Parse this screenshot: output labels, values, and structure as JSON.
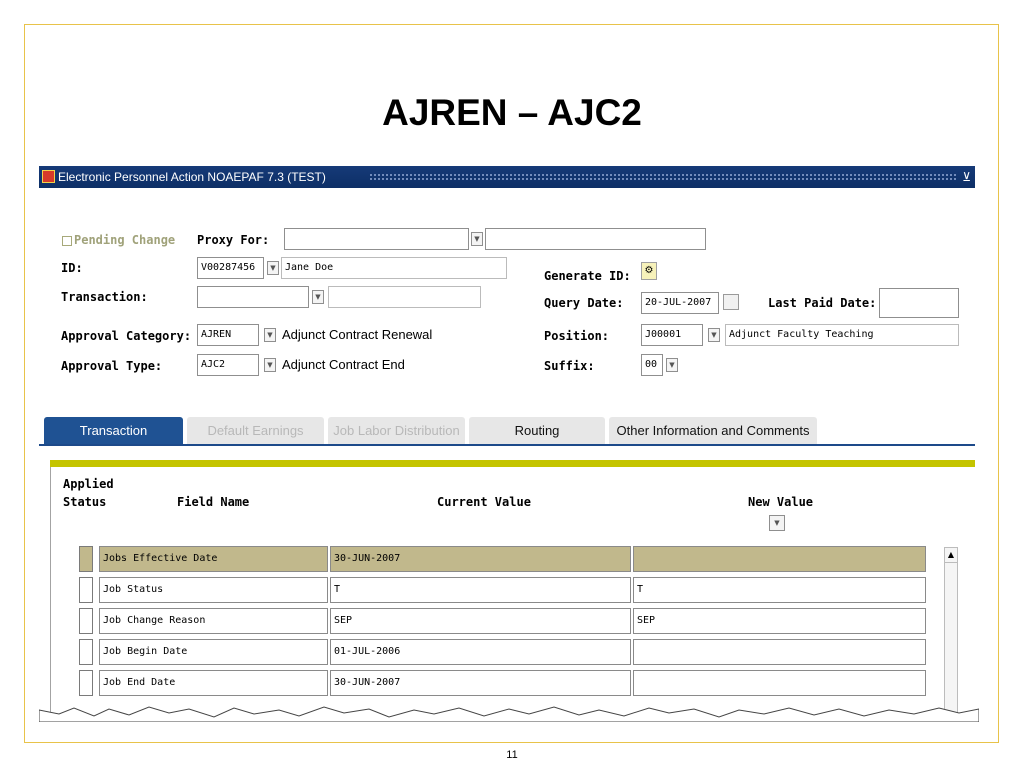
{
  "slide": {
    "title": "AJREN – AJC2",
    "page_number": "11"
  },
  "window": {
    "title": "Electronic Personnel Action  NOAEPAF  7.3  (TEST)",
    "close_glyph": "⊻"
  },
  "form": {
    "pending_change_label": "Pending Change",
    "proxy_for_label": "Proxy For:",
    "proxy_for_value": "",
    "proxy_for_name": "",
    "id_label": "ID:",
    "id_value": "V00287456",
    "id_name": "Jane Doe",
    "transaction_label": "Transaction:",
    "transaction_value": "",
    "transaction_desc": "",
    "approval_category_label": "Approval Category:",
    "approval_category_value": "AJREN",
    "approval_category_desc": "Adjunct Contract Renewal",
    "approval_type_label": "Approval Type:",
    "approval_type_value": "AJC2",
    "approval_type_desc": "Adjunct Contract End",
    "generate_id_label": "Generate ID:",
    "query_date_label": "Query Date:",
    "query_date_value": "20-JUL-2007",
    "last_paid_date_label": "Last Paid Date:",
    "last_paid_date_value": "",
    "position_label": "Position:",
    "position_value": "J00001",
    "position_desc": "Adjunct Faculty Teaching",
    "suffix_label": "Suffix:",
    "suffix_value": "00"
  },
  "tabs": [
    {
      "label": "Transaction",
      "state": "active"
    },
    {
      "label": "Default Earnings",
      "state": "disabled"
    },
    {
      "label": "Job Labor Distribution",
      "state": "disabled"
    },
    {
      "label": "Routing",
      "state": "normal"
    },
    {
      "label": "Other Information and Comments",
      "state": "normal"
    }
  ],
  "grid": {
    "applied_header": "Applied",
    "status_header": "Status",
    "field_name_header": "Field Name",
    "current_value_header": "Current Value",
    "new_value_header": "New Value",
    "rows": [
      {
        "field": "Jobs Effective Date",
        "current": "30-JUN-2007",
        "new": ""
      },
      {
        "field": "Job Status",
        "current": "T",
        "new": "T"
      },
      {
        "field": "Job Change Reason",
        "current": "SEP",
        "new": "SEP"
      },
      {
        "field": "Job Begin Date",
        "current": "01-JUL-2006",
        "new": ""
      },
      {
        "field": "Job End Date",
        "current": "30-JUN-2007",
        "new": ""
      }
    ]
  },
  "colors": {
    "titlebar": "#163a78",
    "active_tab": "#1f5293",
    "highlight_row": "#c1b88c",
    "yellow_bar": "#c4c400",
    "frame_border": "#e8c34a"
  }
}
